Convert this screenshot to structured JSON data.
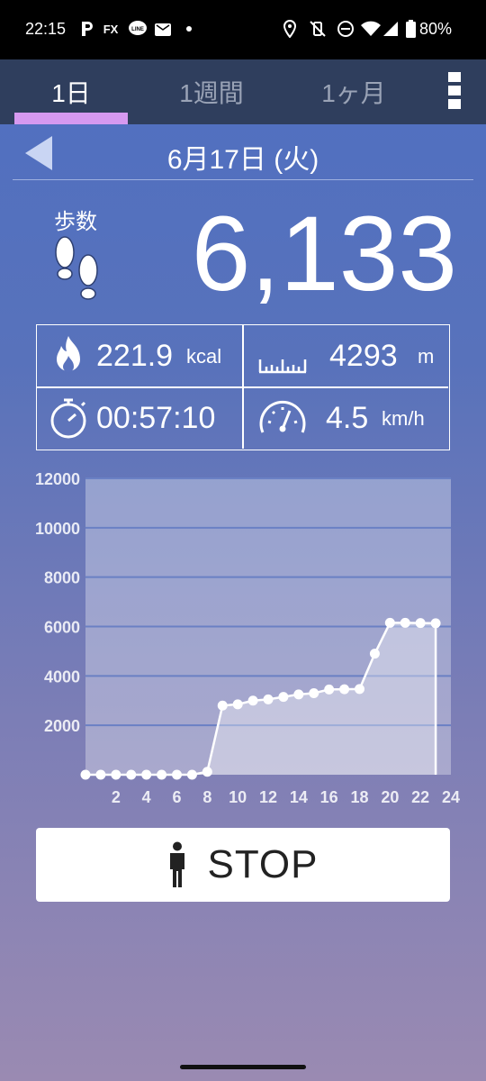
{
  "status_bar": {
    "time": "22:15",
    "icons": [
      "parking-p-icon",
      "fx-icon",
      "line-icon",
      "mail-icon",
      "dot-icon",
      "location-icon",
      "vibrate-off-icon",
      "dnd-icon",
      "wifi-icon",
      "signal-icon",
      "battery-icon"
    ],
    "fx_text": "FX",
    "line_text": "LINE",
    "battery": "80%"
  },
  "tabs": [
    {
      "label": "1日",
      "active": true
    },
    {
      "label": "1週間",
      "active": false
    },
    {
      "label": "1ヶ月",
      "active": false
    }
  ],
  "date": "6月17日 (火)",
  "steps": {
    "label": "歩数",
    "value": "6,133"
  },
  "stats": {
    "calories": {
      "value": "221.9",
      "unit": "kcal"
    },
    "distance": {
      "value": "4293",
      "unit": "m"
    },
    "duration": {
      "value": "00:57:10"
    },
    "speed": {
      "value": "4.5",
      "unit": "km/h"
    }
  },
  "colors": {
    "tabbar": "#2f3e5d",
    "indicator": "#d699f0",
    "accent_white": "#ffffff"
  },
  "chart_data": {
    "type": "area",
    "title": "",
    "xlabel": "",
    "ylabel": "",
    "ylim": [
      0,
      12000
    ],
    "xlim": [
      0,
      24
    ],
    "y_ticks": [
      "2000",
      "4000",
      "6000",
      "8000",
      "10000",
      "12000"
    ],
    "x_ticks": [
      "2",
      "4",
      "6",
      "8",
      "10",
      "12",
      "14",
      "16",
      "18",
      "20",
      "22",
      "24"
    ],
    "grid": true,
    "x": [
      0,
      1,
      2,
      3,
      4,
      5,
      6,
      7,
      8,
      9,
      10,
      11,
      12,
      13,
      14,
      15,
      16,
      17,
      18,
      19,
      20,
      21,
      22,
      23
    ],
    "values": [
      0,
      0,
      0,
      0,
      0,
      0,
      0,
      0,
      120,
      2800,
      2850,
      3000,
      3050,
      3150,
      3250,
      3300,
      3450,
      3460,
      3470,
      4900,
      6150,
      6150,
      6140,
      6133
    ]
  },
  "stop_button": {
    "label": "STOP"
  }
}
